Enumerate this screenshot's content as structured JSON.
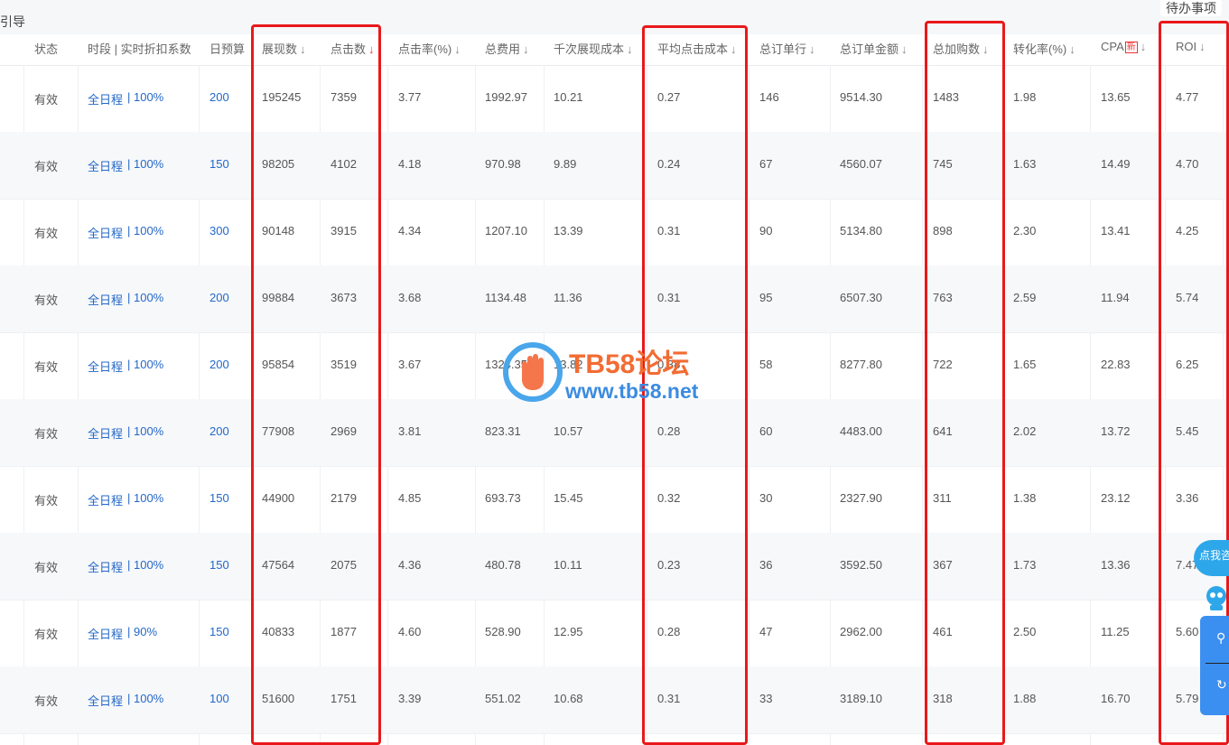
{
  "topbar": {
    "guide_label": "引导",
    "todo_label": "待办事项"
  },
  "columns": [
    {
      "label": "状态",
      "sort": ""
    },
    {
      "label": "时段 | 实时折扣系数",
      "sort": ""
    },
    {
      "label": "日预算",
      "sort": ""
    },
    {
      "label": "展现数",
      "sort": "↓"
    },
    {
      "label": "点击数",
      "sort": "↓"
    },
    {
      "label": "点击率(%)",
      "sort": "↓"
    },
    {
      "label": "总费用",
      "sort": "↓"
    },
    {
      "label": "千次展现成本",
      "sort": "↓"
    },
    {
      "label": "平均点击成本",
      "sort": "↓"
    },
    {
      "label": "总订单行",
      "sort": "↓"
    },
    {
      "label": "总订单金额",
      "sort": "↓"
    },
    {
      "label": "总加购数",
      "sort": "↓"
    },
    {
      "label": "转化率(%)",
      "sort": "↓"
    },
    {
      "label": "CPA",
      "sort": "↓",
      "badge": "新"
    },
    {
      "label": "ROI",
      "sort": "↓"
    }
  ],
  "rows": [
    {
      "status": "有效",
      "schedule": "全日程",
      "discount": "| 100%",
      "budget": "200",
      "impressions": "195245",
      "clicks": "7359",
      "ctr": "3.77",
      "cost": "1992.97",
      "cpm": "10.21",
      "cpc": "0.27",
      "orders": "146",
      "order_amount": "9514.30",
      "add_cart": "1483",
      "cvr": "1.98",
      "cpa": "13.65",
      "roi": "4.77"
    },
    {
      "status": "有效",
      "schedule": "全日程",
      "discount": "| 100%",
      "budget": "150",
      "impressions": "98205",
      "clicks": "4102",
      "ctr": "4.18",
      "cost": "970.98",
      "cpm": "9.89",
      "cpc": "0.24",
      "orders": "67",
      "order_amount": "4560.07",
      "add_cart": "745",
      "cvr": "1.63",
      "cpa": "14.49",
      "roi": "4.70"
    },
    {
      "status": "有效",
      "schedule": "全日程",
      "discount": "| 100%",
      "budget": "300",
      "impressions": "90148",
      "clicks": "3915",
      "ctr": "4.34",
      "cost": "1207.10",
      "cpm": "13.39",
      "cpc": "0.31",
      "orders": "90",
      "order_amount": "5134.80",
      "add_cart": "898",
      "cvr": "2.30",
      "cpa": "13.41",
      "roi": "4.25"
    },
    {
      "status": "有效",
      "schedule": "全日程",
      "discount": "| 100%",
      "budget": "200",
      "impressions": "99884",
      "clicks": "3673",
      "ctr": "3.68",
      "cost": "1134.48",
      "cpm": "11.36",
      "cpc": "0.31",
      "orders": "95",
      "order_amount": "6507.30",
      "add_cart": "763",
      "cvr": "2.59",
      "cpa": "11.94",
      "roi": "5.74"
    },
    {
      "status": "有效",
      "schedule": "全日程",
      "discount": "| 100%",
      "budget": "200",
      "impressions": "95854",
      "clicks": "3519",
      "ctr": "3.67",
      "cost": "1324.35",
      "cpm": "13.82",
      "cpc": "0.38",
      "orders": "58",
      "order_amount": "8277.80",
      "add_cart": "722",
      "cvr": "1.65",
      "cpa": "22.83",
      "roi": "6.25"
    },
    {
      "status": "有效",
      "schedule": "全日程",
      "discount": "| 100%",
      "budget": "200",
      "impressions": "77908",
      "clicks": "2969",
      "ctr": "3.81",
      "cost": "823.31",
      "cpm": "10.57",
      "cpc": "0.28",
      "orders": "60",
      "order_amount": "4483.00",
      "add_cart": "641",
      "cvr": "2.02",
      "cpa": "13.72",
      "roi": "5.45"
    },
    {
      "status": "有效",
      "schedule": "全日程",
      "discount": "| 100%",
      "budget": "150",
      "impressions": "44900",
      "clicks": "2179",
      "ctr": "4.85",
      "cost": "693.73",
      "cpm": "15.45",
      "cpc": "0.32",
      "orders": "30",
      "order_amount": "2327.90",
      "add_cart": "311",
      "cvr": "1.38",
      "cpa": "23.12",
      "roi": "3.36"
    },
    {
      "status": "有效",
      "schedule": "全日程",
      "discount": "| 100%",
      "budget": "150",
      "impressions": "47564",
      "clicks": "2075",
      "ctr": "4.36",
      "cost": "480.78",
      "cpm": "10.11",
      "cpc": "0.23",
      "orders": "36",
      "order_amount": "3592.50",
      "add_cart": "367",
      "cvr": "1.73",
      "cpa": "13.36",
      "roi": "7.47"
    },
    {
      "status": "有效",
      "schedule": "全日程",
      "discount": "| 90%",
      "budget": "150",
      "impressions": "40833",
      "clicks": "1877",
      "ctr": "4.60",
      "cost": "528.90",
      "cpm": "12.95",
      "cpc": "0.28",
      "orders": "47",
      "order_amount": "2962.00",
      "add_cart": "461",
      "cvr": "2.50",
      "cpa": "11.25",
      "roi": "5.60"
    },
    {
      "status": "有效",
      "schedule": "全日程",
      "discount": "| 100%",
      "budget": "100",
      "impressions": "51600",
      "clicks": "1751",
      "ctr": "3.39",
      "cost": "551.02",
      "cpm": "10.68",
      "cpc": "0.31",
      "orders": "33",
      "order_amount": "3189.10",
      "add_cart": "318",
      "cvr": "1.88",
      "cpa": "16.70",
      "roi": "5.79"
    }
  ],
  "watermark": {
    "title": "TB58论坛",
    "url": "www.tb58.net"
  },
  "helper": {
    "label": "点我咨询"
  },
  "colors": {
    "link_blue": "#2468c8",
    "highlight_red": "#e8191b",
    "sort_active": "#e33"
  }
}
